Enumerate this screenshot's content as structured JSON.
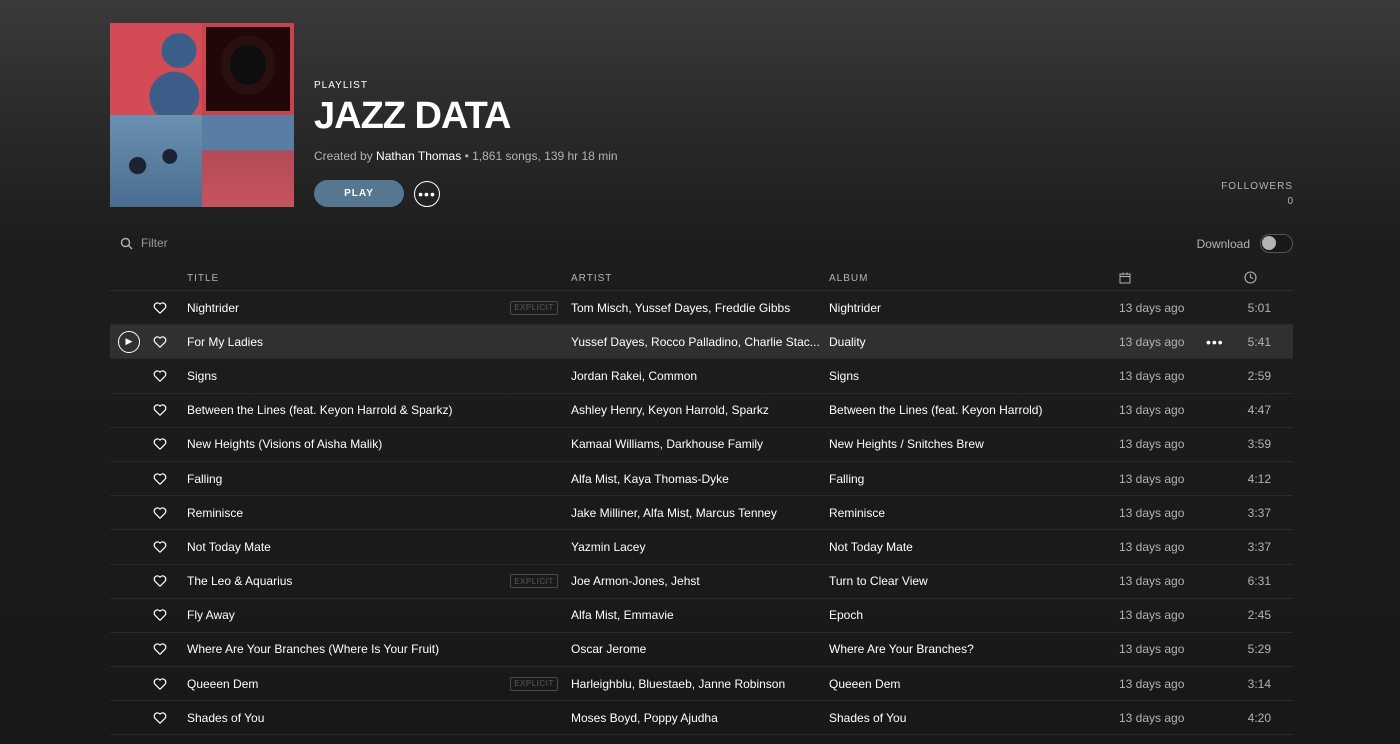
{
  "playlist": {
    "type_label": "PLAYLIST",
    "title": "JAZZ DATA",
    "created_by_prefix": "Created by",
    "owner": "Nathan Thomas",
    "stats": "• 1,861 songs, 139 hr 18 min",
    "play_label": "PLAY",
    "followers_label": "FOLLOWERS",
    "followers_count": "0"
  },
  "toolbar": {
    "filter_placeholder": "Filter",
    "download_label": "Download"
  },
  "table": {
    "headers": {
      "title": "TITLE",
      "artist": "ARTIST",
      "album": "ALBUM"
    },
    "explicit_label": "EXPLICIT",
    "rows": [
      {
        "title": "Nightrider",
        "explicit": true,
        "artist": "Tom Misch, Yussef Dayes, Freddie Gibbs",
        "album": "Nightrider",
        "added": "13 days ago",
        "duration": "5:01"
      },
      {
        "title": "For My Ladies",
        "explicit": false,
        "artist": "Yussef Dayes, Rocco Palladino, Charlie Stac...",
        "album": "Duality",
        "added": "13 days ago",
        "duration": "5:41",
        "hover": true
      },
      {
        "title": "Signs",
        "explicit": false,
        "artist": "Jordan Rakei, Common",
        "album": "Signs",
        "added": "13 days ago",
        "duration": "2:59"
      },
      {
        "title": "Between the Lines (feat. Keyon Harrold & Sparkz)",
        "explicit": false,
        "artist": "Ashley Henry, Keyon Harrold, Sparkz",
        "album": "Between the Lines (feat. Keyon Harrold)",
        "added": "13 days ago",
        "duration": "4:47"
      },
      {
        "title": "New Heights (Visions of Aisha Malik)",
        "explicit": false,
        "artist": "Kamaal Williams, Darkhouse Family",
        "album": "New Heights / Snitches Brew",
        "added": "13 days ago",
        "duration": "3:59"
      },
      {
        "title": "Falling",
        "explicit": false,
        "artist": "Alfa Mist, Kaya Thomas-Dyke",
        "album": "Falling",
        "added": "13 days ago",
        "duration": "4:12"
      },
      {
        "title": "Reminisce",
        "explicit": false,
        "artist": "Jake Milliner, Alfa Mist, Marcus Tenney",
        "album": "Reminisce",
        "added": "13 days ago",
        "duration": "3:37"
      },
      {
        "title": "Not Today Mate",
        "explicit": false,
        "artist": "Yazmin Lacey",
        "album": "Not Today Mate",
        "added": "13 days ago",
        "duration": "3:37"
      },
      {
        "title": "The Leo & Aquarius",
        "explicit": true,
        "artist": "Joe Armon-Jones, Jehst",
        "album": "Turn to Clear View",
        "added": "13 days ago",
        "duration": "6:31"
      },
      {
        "title": "Fly Away",
        "explicit": false,
        "artist": "Alfa Mist, Emmavie",
        "album": "Epoch",
        "added": "13 days ago",
        "duration": "2:45"
      },
      {
        "title": "Where Are Your Branches (Where Is Your Fruit)",
        "explicit": false,
        "artist": "Oscar Jerome",
        "album": "Where Are Your Branches?",
        "added": "13 days ago",
        "duration": "5:29"
      },
      {
        "title": "Queeen Dem",
        "explicit": true,
        "artist": "Harleighblu, Bluestaeb, Janne Robinson",
        "album": "Queeen Dem",
        "added": "13 days ago",
        "duration": "3:14"
      },
      {
        "title": "Shades of You",
        "explicit": false,
        "artist": "Moses Boyd, Poppy Ajudha",
        "album": "Shades of You",
        "added": "13 days ago",
        "duration": "4:20"
      }
    ]
  },
  "icons": {
    "heart": "heart-icon",
    "play": "play-icon",
    "more": "more-icon",
    "search": "search-icon",
    "calendar": "calendar-icon",
    "clock": "clock-icon"
  },
  "colors": {
    "play_button": "#577690",
    "row_hover": "#303030",
    "muted_text": "#b3b3b3"
  }
}
